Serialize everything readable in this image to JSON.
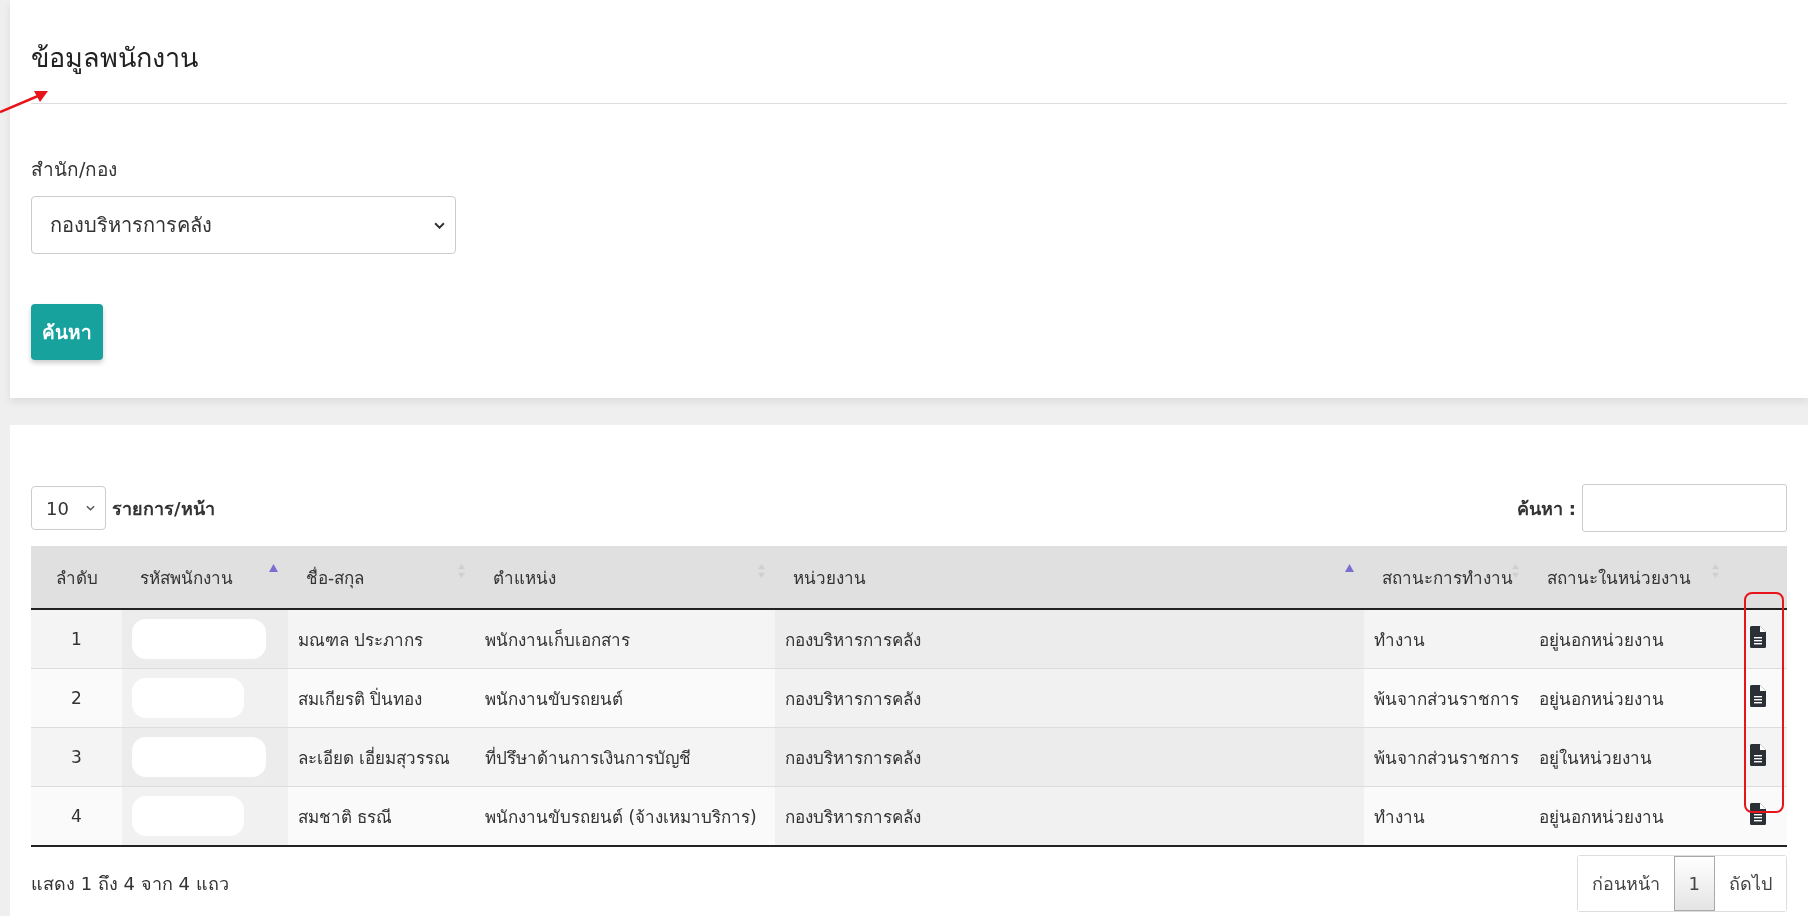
{
  "page_title": "ข้อมูลพนักงาน",
  "filter": {
    "label": "สำนัก/กอง",
    "value": "กองบริหารการคลัง",
    "button": "ค้นหา"
  },
  "length_menu": {
    "value": "10",
    "label": "รายการ/หน้า"
  },
  "search": {
    "label": "ค้นหา :"
  },
  "table": {
    "columns": [
      {
        "label": "ลำดับ",
        "sortable": false
      },
      {
        "label": "รหัสพนักงาน",
        "sortable": true,
        "sorted": true
      },
      {
        "label": "ชื่อ-สกุล",
        "sortable": true,
        "sorted": false
      },
      {
        "label": "ตำแหน่ง",
        "sortable": true,
        "sorted": false
      },
      {
        "label": "หน่วยงาน",
        "sortable": true,
        "sorted": true
      },
      {
        "label": "สถานะการทำงาน",
        "sortable": true,
        "sorted": false
      },
      {
        "label": "สถานะในหน่วยงาน",
        "sortable": true,
        "sorted": false
      }
    ],
    "rows": [
      {
        "no": "1",
        "name": "มณฑล ประภากร",
        "position": "พนักงานเก็บเอกสาร",
        "unit": "กองบริหารการคลัง",
        "work_status": "ทำงาน",
        "unit_status": "อยู่นอกหน่วยงาน"
      },
      {
        "no": "2",
        "name": "สมเกียรติ ปิ่นทอง",
        "position": "พนักงานขับรถยนต์",
        "unit": "กองบริหารการคลัง",
        "work_status": "พ้นจากส่วนราชการ",
        "unit_status": "อยู่นอกหน่วยงาน"
      },
      {
        "no": "3",
        "name": "ละเอียด เอี่ยมสุวรรณ",
        "position": "ที่ปรึษาด้านการเงินการบัญชี",
        "unit": "กองบริหารการคลัง",
        "work_status": "พ้นจากส่วนราชการ",
        "unit_status": "อยู่ในหน่วยงาน"
      },
      {
        "no": "4",
        "name": "สมชาติ ธรณี",
        "position": "พนักงานขับรถยนต์ (จ้างเหมาบริการ)",
        "unit": "กองบริหารการคลัง",
        "work_status": "ทำงาน",
        "unit_status": "อยู่นอกหน่วยงาน"
      }
    ]
  },
  "info": "แสดง 1 ถึง 4 จาก 4 แถว",
  "pagination": [
    {
      "label": "ก่อนหน้า",
      "selected": false
    },
    {
      "label": "1",
      "selected": true
    },
    {
      "label": "ถัดไป",
      "selected": false
    }
  ]
}
